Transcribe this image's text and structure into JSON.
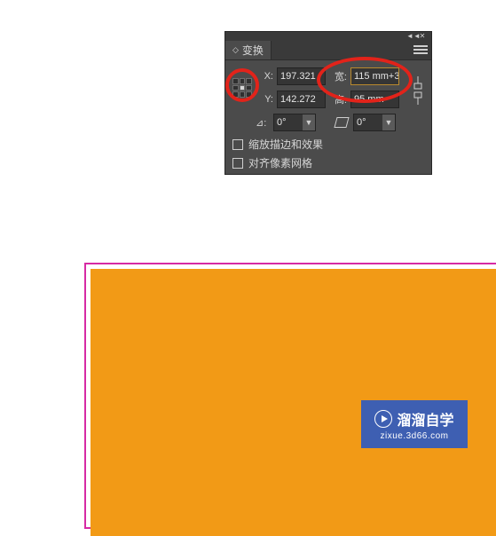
{
  "panel": {
    "title": "变换",
    "x_label": "X:",
    "y_label": "Y:",
    "w_label": "宽:",
    "h_label": "高:",
    "x_value": "197.321",
    "y_value": "142.272",
    "w_value": "115 mm+3",
    "h_value": "95 mm",
    "rotate_label": "⊿:",
    "rotate_value": "0°",
    "shear_value": "0°",
    "checkbox_scale": "缩放描边和效果",
    "checkbox_align": "对齐像素网格",
    "titlebar": {
      "collapse": "◄◄",
      "close": "✕"
    }
  },
  "watermark": {
    "brand": "溜溜自学",
    "url": "zixue.3d66.com"
  },
  "annotation": {
    "circle1": "reference-point-highlight",
    "circle2": "width-height-highlight"
  }
}
